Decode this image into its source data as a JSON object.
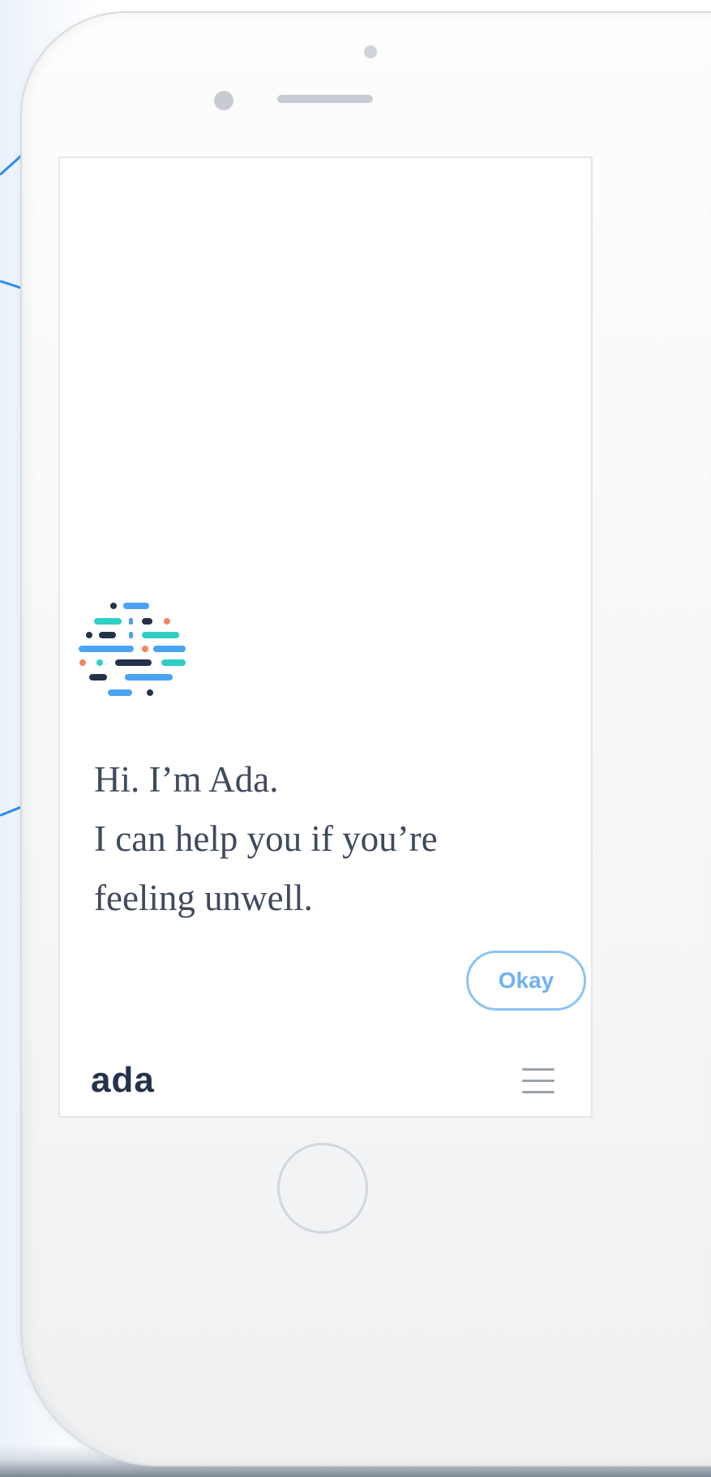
{
  "chat": {
    "greeting_lines": [
      "Hi. I’m Ada.",
      "I can help you if you’re",
      "feeling unwell."
    ],
    "okay_button_label": "Okay"
  },
  "footer": {
    "logo_text": "ada",
    "menu_icon": "hamburger-menu-icon"
  },
  "colors": {
    "accent_blue": "#6eb2f5",
    "text_dark": "#3f4a5b",
    "logo_navy": "#24324a",
    "icon_teal": "#2ecfc4",
    "icon_orange": "#f2855b",
    "icon_blue": "#4aa3f5"
  }
}
